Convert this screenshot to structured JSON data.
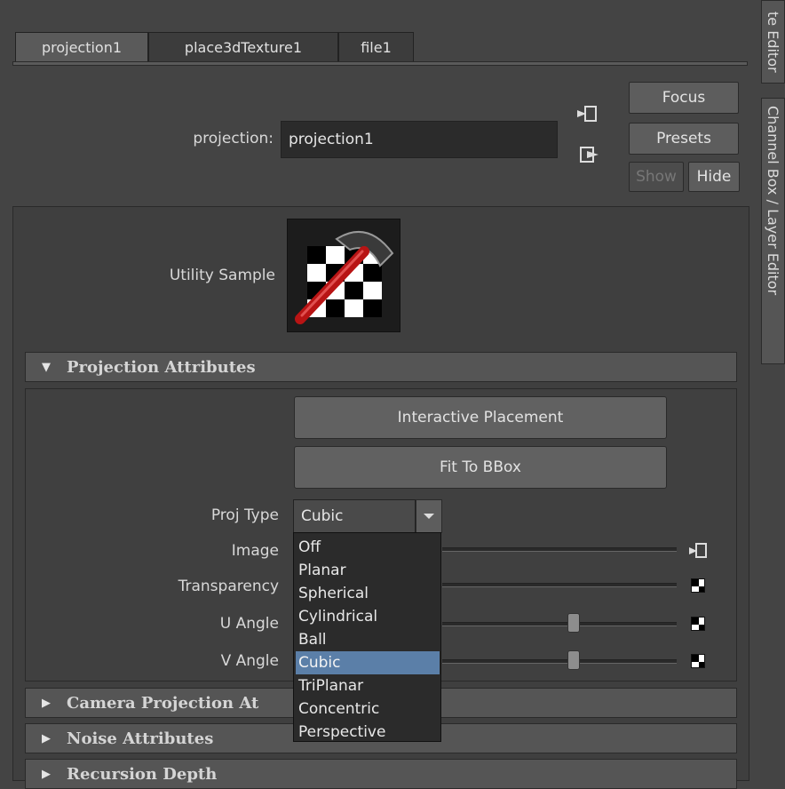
{
  "tabs": [
    "projection1",
    "place3dTexture1",
    "file1"
  ],
  "side_tabs": {
    "attribute_editor": "te Editor",
    "channel_box": "Channel Box / Layer Editor"
  },
  "header": {
    "node_label": "projection:",
    "node_value": "projection1",
    "focus": "Focus",
    "presets": "Presets",
    "show": "Show",
    "hide": "Hide"
  },
  "utility_sample_label": "Utility Sample",
  "sections": {
    "projection": "Projection Attributes",
    "camera": "Camera Projection At",
    "noise": "Noise Attributes",
    "recursion": "Recursion Depth"
  },
  "buttons": {
    "interactive": "Interactive Placement",
    "fit": "Fit To BBox"
  },
  "attributes": {
    "proj_type": "Proj Type",
    "image": "Image",
    "transparency": "Transparency",
    "u_angle": "U Angle",
    "v_angle": "V Angle"
  },
  "proj_type_value": "Cubic",
  "slider_levels": {
    "u_angle": 0.56,
    "v_angle": 0.56
  },
  "dropdown_options": [
    "Off",
    "Planar",
    "Spherical",
    "Cylindrical",
    "Ball",
    "Cubic",
    "TriPlanar",
    "Concentric",
    "Perspective"
  ],
  "selected_option": "Cubic",
  "colors": {
    "highlight": "#5b7fa8",
    "panel": "#444444"
  }
}
